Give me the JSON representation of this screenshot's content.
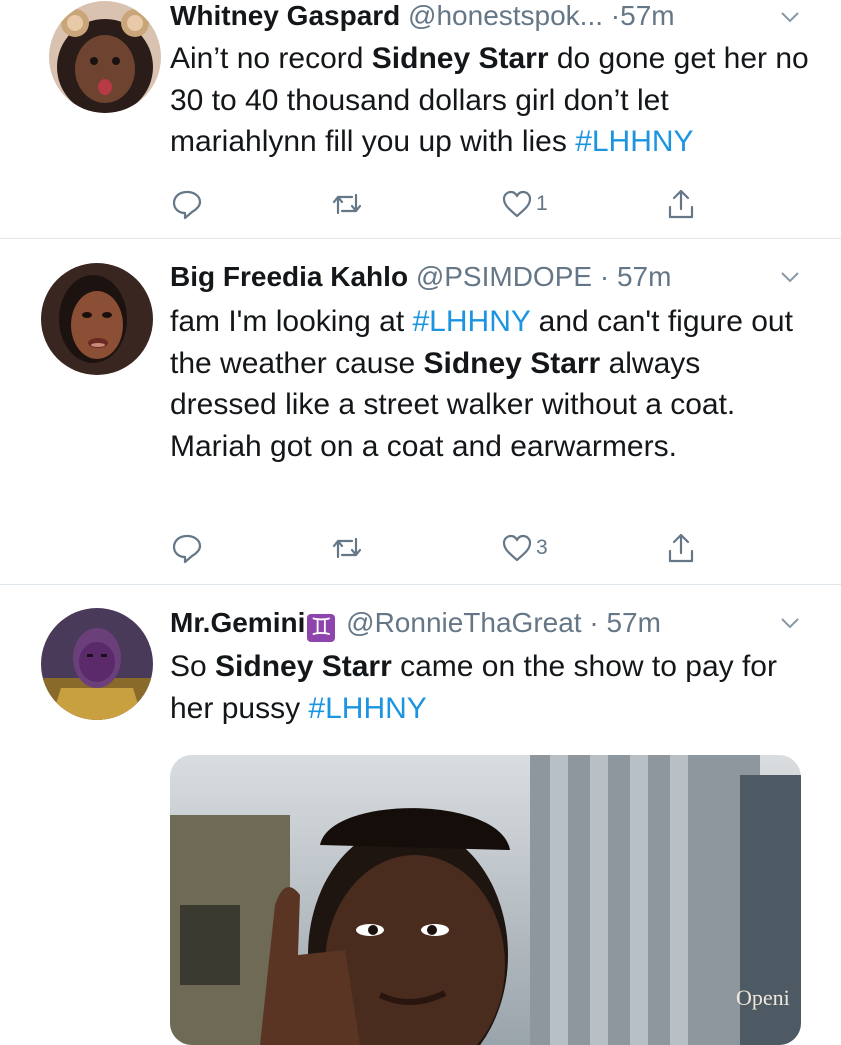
{
  "tweets": [
    {
      "name": "Whitney Gaspard",
      "handle": "@honestspok...",
      "dot": " ·",
      "time": "57m",
      "text": {
        "p1": "Ain’t no record ",
        "b1": "Sidney Starr",
        "p2": " do gone get her no 30 to 40 thousand dollars girl don’t let mariahlynn fill you up with lies  ",
        "tag1": "#LHHNY"
      },
      "likes": "1"
    },
    {
      "name": "Big Freedia Kahlo",
      "handle": "@PSIMDOPE",
      "dot": " · ",
      "time": "57m",
      "text": {
        "p1": "fam I'm looking at ",
        "tag1": "#LHHNY",
        "p2": " and can't figure out the weather cause ",
        "b1": "Sidney Starr",
        "p3": " always dressed like a street walker without a coat. Mariah got on a coat and earwarmers."
      },
      "likes": "3"
    },
    {
      "name": "Mr.Gemini",
      "badge": "♊",
      "handle": "@RonnieThaGreat",
      "dot": " · ",
      "time": "57m",
      "text": {
        "p1": "So ",
        "b1": "Sidney Starr",
        "p2": " came on the show to pay for her pussy ",
        "tag1": "#LHHNY"
      },
      "media_sign": "Openi"
    }
  ],
  "icons": {
    "reply": "reply-icon",
    "retweet": "retweet-icon",
    "like": "heart-icon",
    "share": "share-icon",
    "menu": "chevron-down-icon"
  },
  "colors": {
    "link": "#1b95e0",
    "muted": "#657786",
    "text": "#14171a",
    "divider": "#e1e8ed",
    "badge": "#8e44ad"
  }
}
